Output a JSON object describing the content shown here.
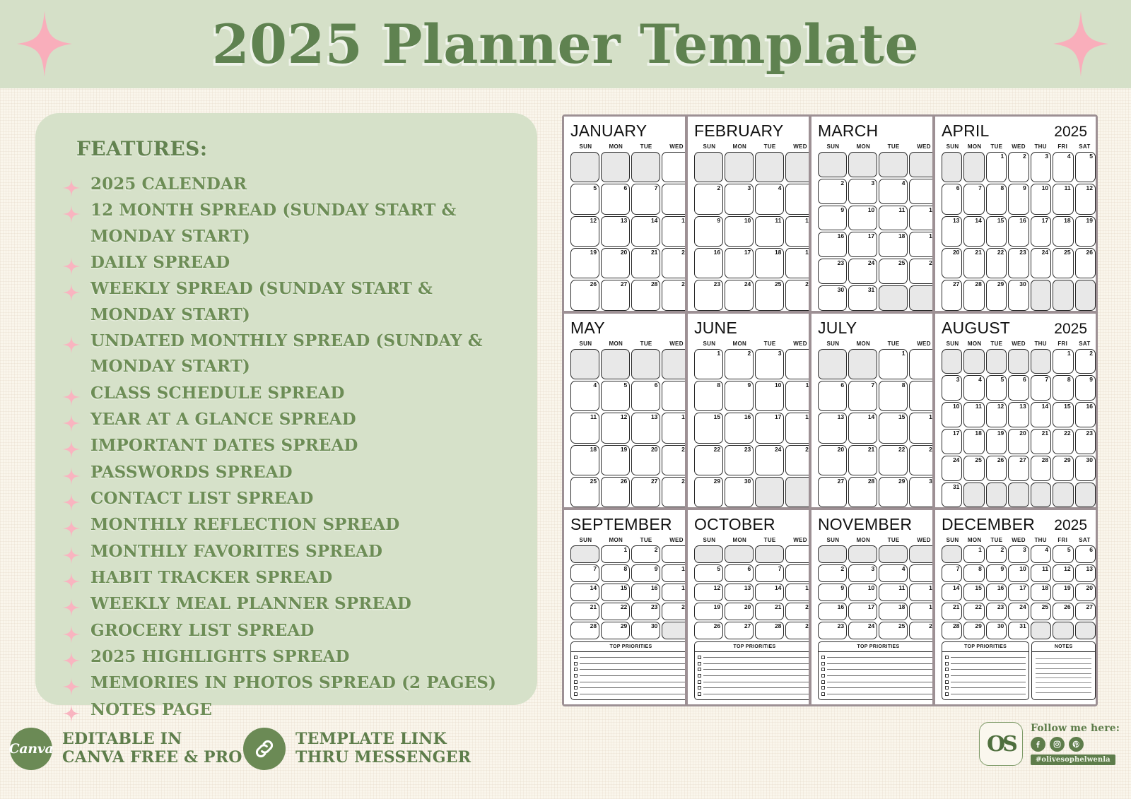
{
  "header": {
    "title": "2025 Planner Template",
    "sparkle_left": "sparkle-star-icon",
    "sparkle_right": "sparkle-star-icon"
  },
  "features": {
    "heading": "FEATURES:",
    "items": [
      "2025 CALENDAR",
      "12 MONTH SPREAD (SUNDAY START & MONDAY START)",
      "DAILY SPREAD",
      "WEEKLY SPREAD (SUNDAY START & MONDAY START)",
      "UNDATED MONTHLY SPREAD (SUNDAY & MONDAY START)",
      "CLASS SCHEDULE SPREAD",
      "YEAR AT A GLANCE SPREAD",
      "IMPORTANT DATES SPREAD",
      "PASSWORDS SPREAD",
      "CONTACT LIST SPREAD",
      "MONTHLY REFLECTION SPREAD",
      "MONTHLY FAVORITES SPREAD",
      "HABIT TRACKER SPREAD",
      "WEEKLY MEAL PLANNER SPREAD",
      "GROCERY LIST SPREAD",
      "2025 HIGHLIGHTS SPREAD",
      "MEMORIES IN PHOTOS SPREAD (2 PAGES)",
      "NOTES PAGE"
    ]
  },
  "calendar": {
    "year": "2025",
    "day_names": [
      "SUN",
      "MON",
      "TUE",
      "WED",
      "THU",
      "FRI",
      "SAT"
    ],
    "priorities_title": "TOP PRIORITIES",
    "notes_title": "NOTES",
    "priority_rows": 7,
    "note_rows": 8,
    "rows": [
      {
        "months": [
          {
            "name": "JANUARY",
            "start": 3,
            "days": 31,
            "weeks": 5
          },
          {
            "name": "FEBRUARY",
            "start": 6,
            "days": 28,
            "weeks": 5
          },
          {
            "name": "MARCH",
            "start": 6,
            "days": 31,
            "weeks": 6
          },
          {
            "name": "APRIL",
            "start": 2,
            "days": 30,
            "weeks": 5
          }
        ]
      },
      {
        "months": [
          {
            "name": "MAY",
            "start": 4,
            "days": 31,
            "weeks": 5
          },
          {
            "name": "JUNE",
            "start": 0,
            "days": 30,
            "weeks": 5
          },
          {
            "name": "JULY",
            "start": 2,
            "days": 31,
            "weeks": 5
          },
          {
            "name": "AUGUST",
            "start": 5,
            "days": 31,
            "weeks": 6
          }
        ]
      },
      {
        "months": [
          {
            "name": "SEPTEMBER",
            "start": 1,
            "days": 30,
            "weeks": 5
          },
          {
            "name": "OCTOBER",
            "start": 3,
            "days": 31,
            "weeks": 5
          },
          {
            "name": "NOVEMBER",
            "start": 6,
            "days": 30,
            "weeks": 5
          },
          {
            "name": "DECEMBER",
            "start": 1,
            "days": 31,
            "weeks": 5
          }
        ]
      }
    ]
  },
  "footer": {
    "canva_badge": {
      "logo_text": "Canva",
      "label_line1": "EDITABLE IN",
      "label_line2": "CANVA FREE & PRO"
    },
    "link_badge": {
      "icon": "chain-link-icon",
      "label_line1": "TEMPLATE LINK",
      "label_line2": "THRU MESSENGER"
    },
    "follow": {
      "logo_monogram": "OS",
      "title": "Follow me here:",
      "socials": [
        "facebook-icon",
        "instagram-icon",
        "pinterest-icon"
      ],
      "handle": "#olivesophelwenla"
    }
  },
  "colors": {
    "band_green": "#d5e0c8",
    "panel_green": "#d6e1c9",
    "text_green": "#6d8d56",
    "title_green": "#5f8250",
    "accent_pink": "#f9aebb",
    "page_cream": "#faf6ec",
    "calendar_frame": "#9d9094"
  }
}
